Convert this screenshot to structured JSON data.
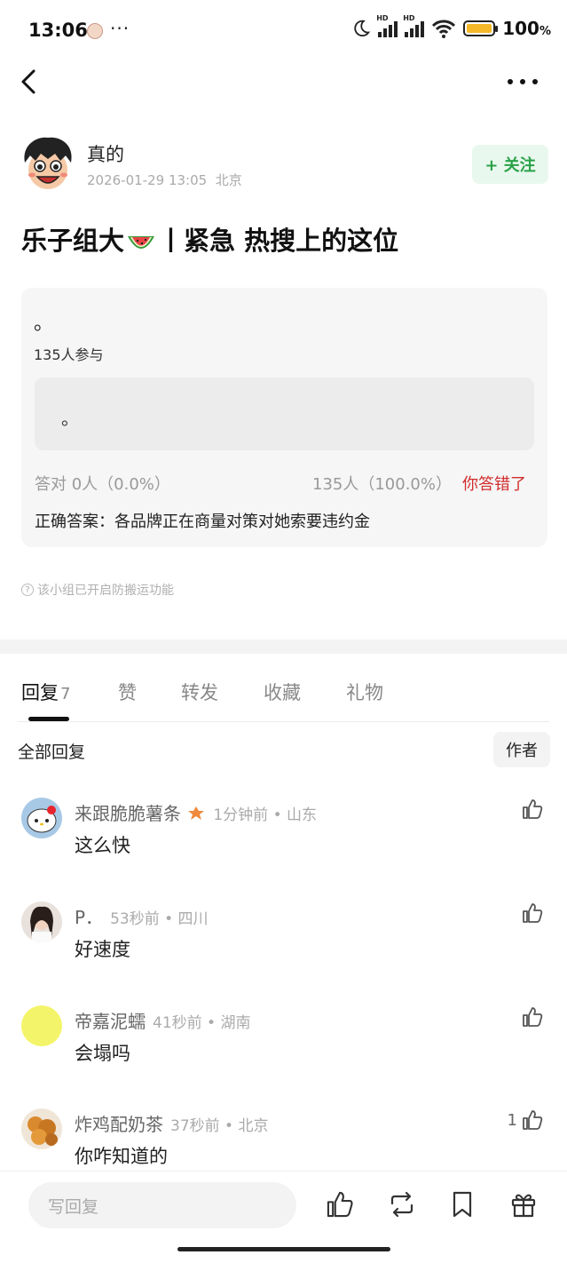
{
  "status": {
    "time": "13:06",
    "battery": "100",
    "battery_unit": "%",
    "net_label": "HD"
  },
  "post": {
    "author_name": "真的",
    "date": "2026-01-29 13:05",
    "location": "北京",
    "follow_label": "+ 关注",
    "title_prefix": "乐子组大",
    "title_suffix": "丨紧急 热搜上的这位"
  },
  "quiz": {
    "question": "。",
    "participants": "135人参与",
    "option_text": "。",
    "correct_stats": "答对  0人（0.0%）",
    "wrong_stats": "135人（100.0%）",
    "wrong_label": "你答错了",
    "answer": "正确答案：各品牌正在商量对策对她索要违约金"
  },
  "notice": "该小组已开启防搬运功能",
  "tabs": [
    {
      "label": "回复",
      "count": "7"
    },
    {
      "label": "赞"
    },
    {
      "label": "转发"
    },
    {
      "label": "收藏"
    },
    {
      "label": "礼物"
    }
  ],
  "filter": {
    "all": "全部回复",
    "author": "作者"
  },
  "comments": [
    {
      "name": "来跟脆脆薯条",
      "time": "1分钟前",
      "location": "山东",
      "text": "这么快",
      "likes": ""
    },
    {
      "name": "P．",
      "time": "53秒前",
      "location": "四川",
      "text": "好速度",
      "likes": ""
    },
    {
      "name": "帝嘉泥蠕",
      "time": "41秒前",
      "location": "湖南",
      "text": "会塌吗",
      "likes": ""
    },
    {
      "name": "炸鸡配奶茶",
      "time": "37秒前",
      "location": "北京",
      "text": "你咋知道的",
      "likes": "1"
    }
  ],
  "bottom": {
    "reply_placeholder": "写回复"
  },
  "colors": {
    "accent_green": "#2aa148",
    "follow_bg": "#e9f8ee",
    "wrong_red": "#d12d2d",
    "card_bg": "#f6f6f6"
  }
}
